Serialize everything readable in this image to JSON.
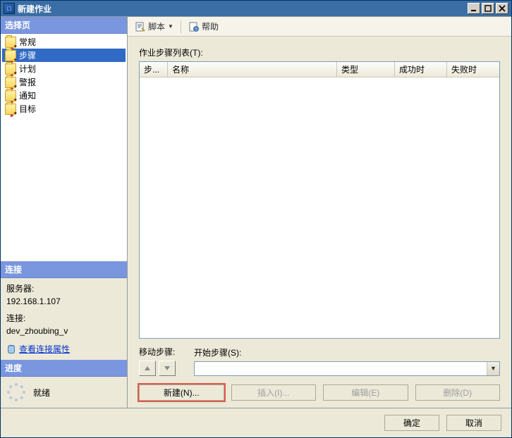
{
  "window": {
    "title": "新建作业"
  },
  "toolbar": {
    "script": "脚本",
    "help": "帮助"
  },
  "nav": {
    "heading": "选择页",
    "items": [
      {
        "label": "常规"
      },
      {
        "label": "步骤"
      },
      {
        "label": "计划"
      },
      {
        "label": "警报"
      },
      {
        "label": "通知"
      },
      {
        "label": "目标"
      }
    ]
  },
  "connection": {
    "heading": "连接",
    "server_label": "服务器:",
    "server_value": "192.168.1.107",
    "conn_label": "连接:",
    "conn_value": "dev_zhoubing_v",
    "view_props": "查看连接属性"
  },
  "progress": {
    "heading": "进度",
    "status": "就绪"
  },
  "main": {
    "list_label": "作业步骤列表(T):",
    "columns": {
      "step": "步...",
      "name": "名称",
      "type": "类型",
      "success": "成功时",
      "fail": "失败时"
    },
    "move_label": "移动步骤:",
    "start_label": "开始步骤(S):"
  },
  "buttons": {
    "new": "新建(N)...",
    "insert": "插入(I)...",
    "edit": "编辑(E)",
    "delete": "删除(D)",
    "ok": "确定",
    "cancel": "取消"
  }
}
